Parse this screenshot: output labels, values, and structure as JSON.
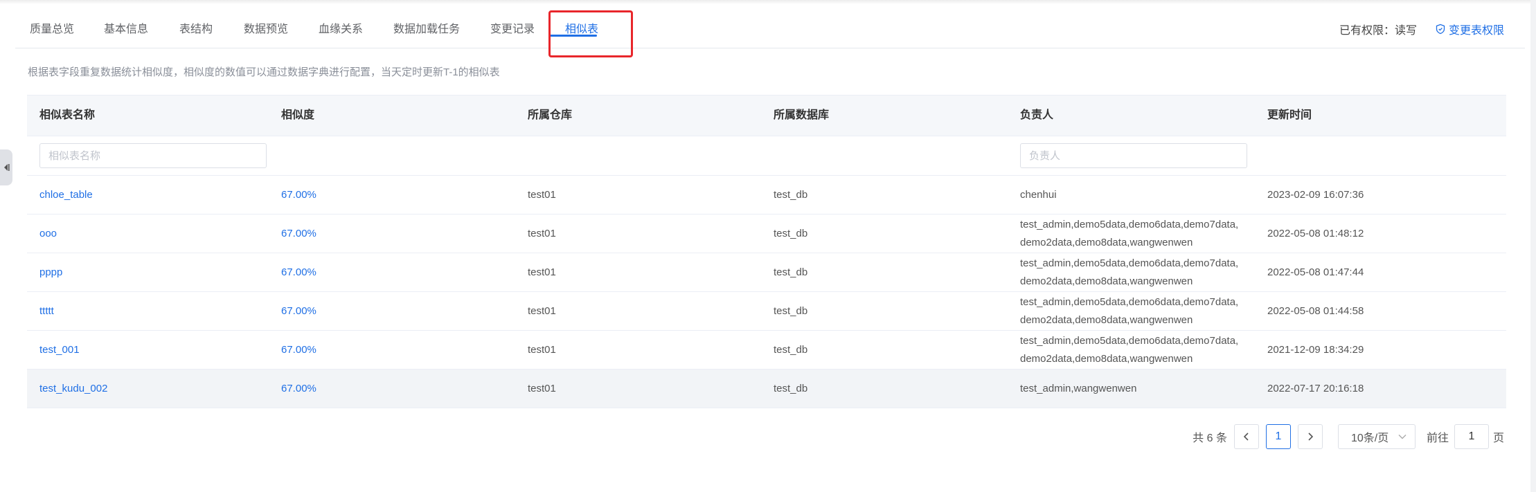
{
  "tabs": [
    {
      "label": "质量总览"
    },
    {
      "label": "基本信息"
    },
    {
      "label": "表结构"
    },
    {
      "label": "数据预览"
    },
    {
      "label": "血缘关系"
    },
    {
      "label": "数据加载任务"
    },
    {
      "label": "变更记录"
    },
    {
      "label": "相似表"
    }
  ],
  "active_tab": "相似表",
  "permission": {
    "text": "已有权限：读写",
    "change_link": "变更表权限"
  },
  "description": "根据表字段重复数据统计相似度，相似度的数值可以通过数据字典进行配置，当天定时更新T-1的相似表",
  "table": {
    "headers": [
      "相似表名称",
      "相似度",
      "所属仓库",
      "所属数据库",
      "负责人",
      "更新时间"
    ],
    "filters": {
      "name_placeholder": "相似表名称",
      "owner_placeholder": "负责人"
    },
    "rows": [
      {
        "name": "chloe_table",
        "similarity": "67.00%",
        "warehouse": "test01",
        "database": "test_db",
        "owner_line1": "chenhui",
        "owner_line2": "",
        "updated": "2023-02-09 16:07:36"
      },
      {
        "name": "ooo",
        "similarity": "67.00%",
        "warehouse": "test01",
        "database": "test_db",
        "owner_line1": "test_admin,demo5data,demo6data,demo7data,",
        "owner_line2": "demo2data,demo8data,wangwenwen",
        "updated": "2022-05-08 01:48:12"
      },
      {
        "name": "pppp",
        "similarity": "67.00%",
        "warehouse": "test01",
        "database": "test_db",
        "owner_line1": "test_admin,demo5data,demo6data,demo7data,",
        "owner_line2": "demo2data,demo8data,wangwenwen",
        "updated": "2022-05-08 01:47:44"
      },
      {
        "name": "ttttt",
        "similarity": "67.00%",
        "warehouse": "test01",
        "database": "test_db",
        "owner_line1": "test_admin,demo5data,demo6data,demo7data,",
        "owner_line2": "demo2data,demo8data,wangwenwen",
        "updated": "2022-05-08 01:44:58"
      },
      {
        "name": "test_001",
        "similarity": "67.00%",
        "warehouse": "test01",
        "database": "test_db",
        "owner_line1": "test_admin,demo5data,demo6data,demo7data,",
        "owner_line2": "demo2data,demo8data,wangwenwen",
        "updated": "2021-12-09 18:34:29"
      },
      {
        "name": "test_kudu_002",
        "similarity": "67.00%",
        "warehouse": "test01",
        "database": "test_db",
        "owner_line1": "test_admin,wangwenwen",
        "owner_line2": "",
        "updated": "2022-07-17 20:16:18"
      }
    ]
  },
  "pagination": {
    "total": "共 6 条",
    "current_page": "1",
    "page_size": "10条/页",
    "goto_label": "前往",
    "goto_value": "1",
    "page_suffix": "页"
  },
  "colors": {
    "accent": "#1f6fe5",
    "highlight_box": "#e8262b",
    "header_bg": "#f5f7fa"
  }
}
